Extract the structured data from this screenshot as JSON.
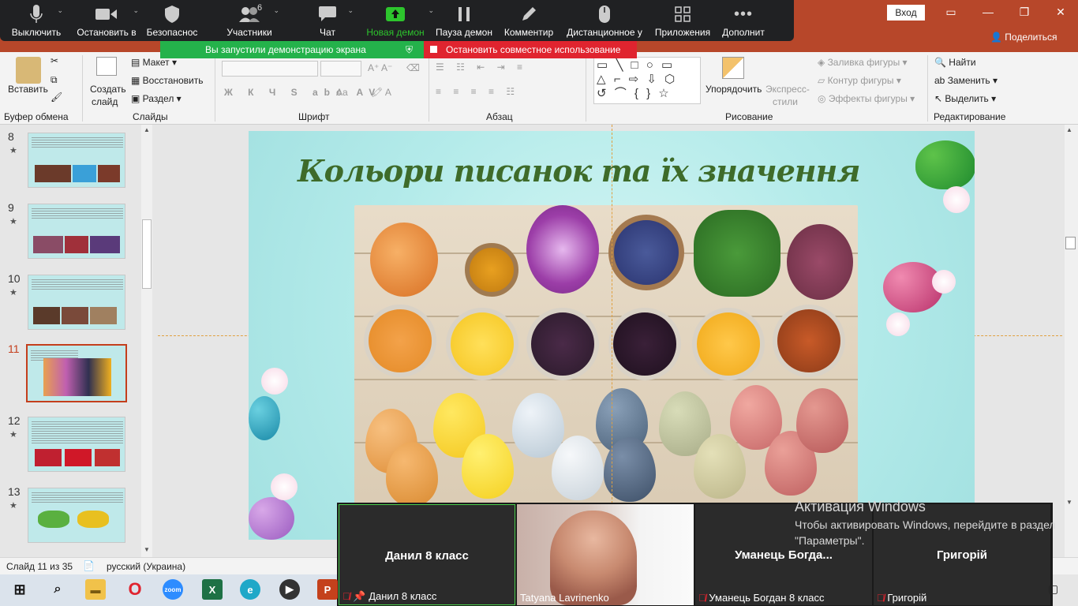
{
  "powerpoint": {
    "login": "Вход",
    "share": "Поделиться",
    "ribbon": {
      "clipboard": {
        "paste": "Вставить",
        "group": "Буфер обмена"
      },
      "slides": {
        "new_slide_1": "Создать",
        "new_slide_2": "слайд",
        "layout": "Макет",
        "reset": "Восстановить",
        "section": "Раздел",
        "group": "Слайды"
      },
      "font": {
        "group": "Шрифт",
        "size_label": "Aa",
        "buttons": [
          "Ж",
          "К",
          "Ч",
          "S",
          "abc",
          "AV"
        ]
      },
      "paragraph": {
        "group": "Абзац"
      },
      "drawing": {
        "arrange_1": "Упорядочить",
        "quick_styles_1": "Экспресс-",
        "quick_styles_2": "стили",
        "fill": "Заливка фигуры",
        "outline": "Контур фигуры",
        "effects": "Эффекты фигуры",
        "group": "Рисование"
      },
      "editing": {
        "find": "Найти",
        "replace": "Заменить",
        "select": "Выделить",
        "group": "Редактирование"
      }
    },
    "thumbnails": [
      {
        "num": "8",
        "star": "★"
      },
      {
        "num": "9",
        "star": "★"
      },
      {
        "num": "10",
        "star": "★"
      },
      {
        "num": "11",
        "star": ""
      },
      {
        "num": "12",
        "star": "★"
      },
      {
        "num": "13",
        "star": "★"
      }
    ],
    "slide": {
      "title": "Кольори писанок та їх значення"
    },
    "status": {
      "slide_counter": "Слайд 11 из 35",
      "language": "русский (Украина)"
    }
  },
  "zoom": {
    "toolbar": [
      {
        "label": "Выключить",
        "icon": "microphone-icon"
      },
      {
        "label": "Остановить в",
        "icon": "video-camera-icon"
      },
      {
        "label": "Безопаснос",
        "icon": "shield-icon"
      },
      {
        "label": "Участники",
        "icon": "participants-icon",
        "count": "6"
      },
      {
        "label": "Чат",
        "icon": "chat-icon"
      },
      {
        "label": "Новая демон",
        "icon": "share-screen-icon"
      },
      {
        "label": "Пауза демон",
        "icon": "pause-icon"
      },
      {
        "label": "Комментир",
        "icon": "annotate-pencil-icon"
      },
      {
        "label": "Дистанционное у",
        "icon": "remote-control-icon"
      },
      {
        "label": "Приложения",
        "icon": "apps-icon"
      },
      {
        "label": "Дополнит",
        "icon": "more-icon"
      }
    ],
    "banner": {
      "sharing": "Вы запустили демонстрацию экрана",
      "stop": "Остановить совместное использование"
    },
    "participants": [
      {
        "display": "Данил 8 класс",
        "label": "Данил 8 класс"
      },
      {
        "display": "",
        "label": "Tatyana Lavrinenko"
      },
      {
        "display": "Уманець  Богда...",
        "label": "Уманець Богдан 8 класс"
      },
      {
        "display": "Григорій",
        "label": "Григорій"
      }
    ]
  },
  "windows": {
    "activation_title": "Активация Windows",
    "activation_text": "Чтобы активировать Windows, перейдите в раздел \"Параметры\".",
    "taskbar": [
      "windows-start-icon",
      "search-icon",
      "file-explorer-icon",
      "opera-icon",
      "zoom-app-icon",
      "excel-icon",
      "edge-icon",
      "media-player-icon",
      "powerpoint-icon"
    ]
  },
  "colors": {
    "ppt_accent": "#b7472a",
    "zoom_bar": "#202123",
    "share_green": "#24b24b",
    "stop_red": "#e0242f",
    "title_green": "#3e6b2a"
  }
}
